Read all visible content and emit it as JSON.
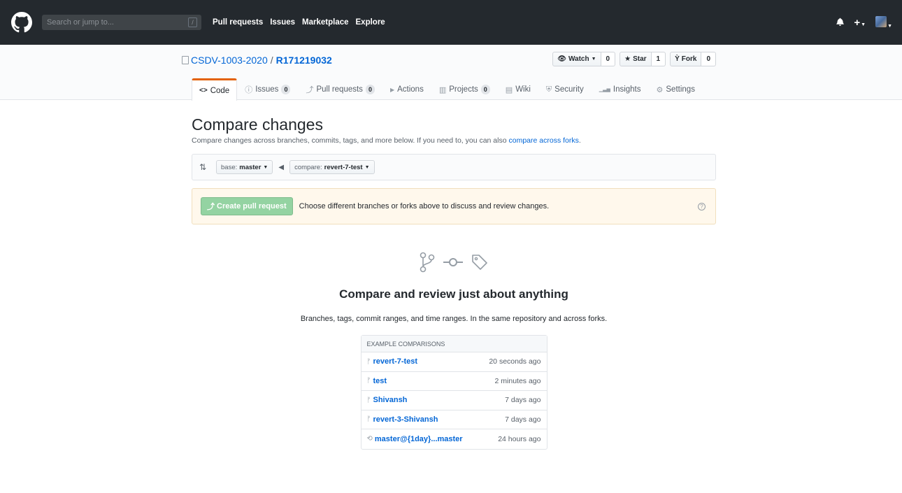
{
  "header": {
    "search_placeholder": "Search or jump to...",
    "search_key": "/",
    "nav": [
      "Pull requests",
      "Issues",
      "Marketplace",
      "Explore"
    ],
    "plus": "+"
  },
  "repo": {
    "owner": "CSDV-1003-2020",
    "separator": "/",
    "name": "R171219032",
    "watch_label": "Watch",
    "watch_count": "0",
    "star_label": "Star",
    "star_count": "1",
    "fork_label": "Fork",
    "fork_count": "0"
  },
  "tabs": [
    {
      "label": "Code",
      "icon": "code-icon",
      "glyph": "<>",
      "count": ""
    },
    {
      "label": "Issues",
      "icon": "issue-icon",
      "glyph": "ⓘ",
      "count": "0"
    },
    {
      "label": "Pull requests",
      "icon": "pull-request-icon",
      "glyph": "⤴",
      "count": "0"
    },
    {
      "label": "Actions",
      "icon": "play-icon",
      "glyph": "▶",
      "count": ""
    },
    {
      "label": "Projects",
      "icon": "project-icon",
      "glyph": "▥",
      "count": "0"
    },
    {
      "label": "Wiki",
      "icon": "book-icon",
      "glyph": "▤",
      "count": ""
    },
    {
      "label": "Security",
      "icon": "shield-icon",
      "glyph": "⛨",
      "count": ""
    },
    {
      "label": "Insights",
      "icon": "graph-icon",
      "glyph": "▁▃▅",
      "count": ""
    },
    {
      "label": "Settings",
      "icon": "gear-icon",
      "glyph": "⚙",
      "count": ""
    }
  ],
  "compare": {
    "title": "Compare changes",
    "description": "Compare changes across branches, commits, tags, and more below. If you need to, you can also",
    "forks_link": "compare across forks",
    "period": ".",
    "base_prefix": "base:",
    "base_branch": "master",
    "compare_prefix": "compare:",
    "compare_branch": "revert-7-test",
    "create_pr_label": "Create pull request",
    "flash_message": "Choose different branches or forks above to discuss and review changes.",
    "help": "?"
  },
  "blankslate": {
    "heading": "Compare and review just about anything",
    "text": "Branches, tags, commit ranges, and time ranges. In the same repository and across forks."
  },
  "examples": {
    "header": "EXAMPLE COMPARISONS",
    "rows": [
      {
        "icon": "branch-icon",
        "label": "revert-7-test",
        "time": "20 seconds ago"
      },
      {
        "icon": "branch-icon",
        "label": "test",
        "time": "2 minutes ago"
      },
      {
        "icon": "branch-icon",
        "label": "Shivansh",
        "time": "7 days ago"
      },
      {
        "icon": "branch-icon",
        "label": "revert-3-Shivansh",
        "time": "7 days ago"
      },
      {
        "icon": "history-icon",
        "label": "master@{1day}...master",
        "time": "24 hours ago"
      }
    ]
  },
  "colors": {
    "header_bg": "#24292e",
    "link": "#0366d6",
    "tab_accent": "#e36209",
    "create_button": "#94d3a2",
    "flash_bg": "#fff8ec"
  }
}
